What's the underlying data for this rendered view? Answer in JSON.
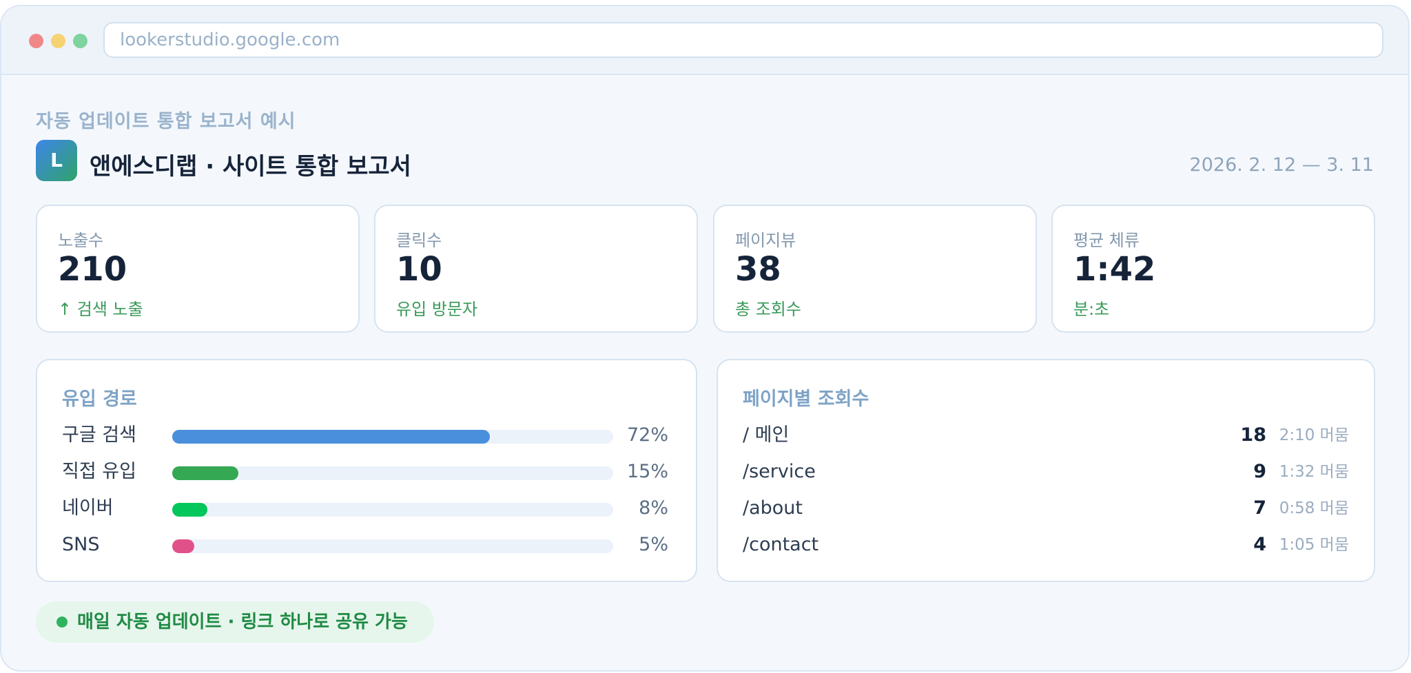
{
  "browser": {
    "url": "lookerstudio.google.com"
  },
  "header": {
    "kicker": "자동 업데이트 통합 보고서 예시",
    "logo_letter": "L",
    "title": "앤에스디랩 · 사이트 통합 보고서",
    "date_range": "2026. 2. 12 — 3. 11"
  },
  "kpis": [
    {
      "label": "노출수",
      "value": "210",
      "sub": "↑ 검색 노출"
    },
    {
      "label": "클릭수",
      "value": "10",
      "sub": "유입 방문자"
    },
    {
      "label": "페이지뷰",
      "value": "38",
      "sub": "총 조회수"
    },
    {
      "label": "평균 체류",
      "value": "1:42",
      "sub": "분:초"
    }
  ],
  "traffic": {
    "title": "유입 경로",
    "sources": [
      {
        "label": "구글 검색",
        "pct_label": "72%",
        "share": 0.72,
        "color": "#4a8fdc"
      },
      {
        "label": "직접 유입",
        "pct_label": "15%",
        "share": 0.15,
        "color": "#34a853"
      },
      {
        "label": "네이버",
        "pct_label": "8%",
        "share": 0.08,
        "color": "#03c75a"
      },
      {
        "label": "SNS",
        "pct_label": "5%",
        "share": 0.05,
        "color": "#e0518a"
      }
    ]
  },
  "pages": {
    "title": "페이지별 조회수",
    "rows": [
      {
        "path": "/ 메인",
        "views": "18",
        "dwell": "2:10 머뭄"
      },
      {
        "path": "/service",
        "views": "9",
        "dwell": "1:32 머뭄"
      },
      {
        "path": "/about",
        "views": "7",
        "dwell": "0:58 머뭄"
      },
      {
        "path": "/contact",
        "views": "4",
        "dwell": "1:05 머뭄"
      }
    ]
  },
  "footer": {
    "text": "매일 자동 업데이트 · 링크 하나로 공유 가능"
  }
}
